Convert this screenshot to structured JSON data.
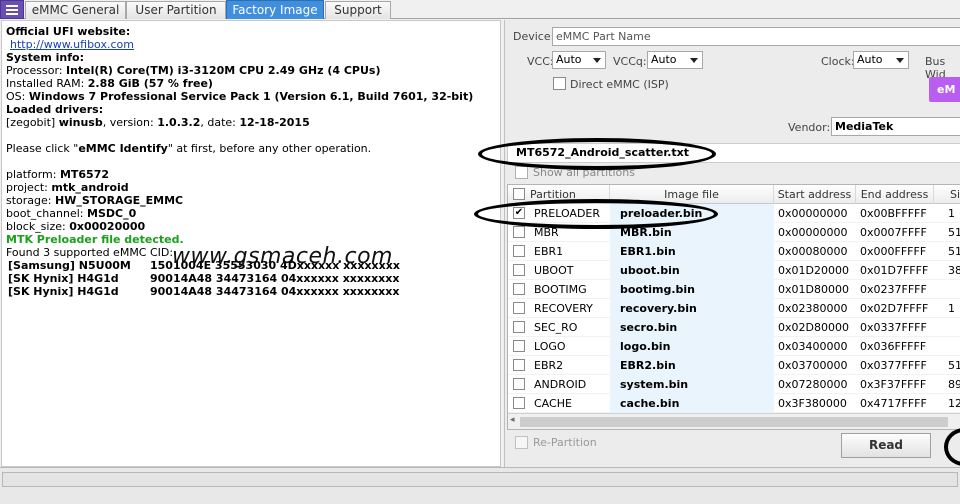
{
  "tabs": [
    {
      "label": "eMMC General"
    },
    {
      "label": "User Partition"
    },
    {
      "label": "Factory Image"
    },
    {
      "label": "Support"
    }
  ],
  "log": {
    "official_site_label": "Official UFI website:",
    "official_site_url": "http://www.ufibox.com",
    "system_info_label": "System info:",
    "processor_label": "Processor: ",
    "processor_value": "Intel(R) Core(TM) i3-3120M CPU 2.49 GHz (4 CPUs)",
    "ram_label": "Installed RAM: ",
    "ram_value": "2.88 GiB (57 % free)",
    "os_label": "OS: ",
    "os_value": "Windows 7 Professional Service Pack 1 (Version 6.1, Build 7601, 32-bit)",
    "drivers_label": "Loaded drivers:",
    "driver_prefix": "[zegobit] ",
    "driver_name": "winusb",
    "driver_version_label": ", version: ",
    "driver_version": "1.0.3.2",
    "driver_date_label": ", date: ",
    "driver_date": "12-18-2015",
    "identify_pre": "Please click \"",
    "identify_bold": "eMMC Identify",
    "identify_post": "\" at first, before any other operation.",
    "platform_label": "platform: ",
    "platform_value": "MT6572",
    "project_label": "project: ",
    "project_value": "mtk_android",
    "storage_label": "storage: ",
    "storage_value": "HW_STORAGE_EMMC",
    "boot_channel_label": "boot_channel: ",
    "boot_channel_value": "MSDC_0",
    "block_size_label": "block_size: ",
    "block_size_value": "0x00020000",
    "preloader_detected": "MTK Preloader file detected.",
    "found_cid": "Found 3 supported eMMC CID:",
    "cid_rows": [
      {
        "name": "[Samsung] N5U00M",
        "cid": "1501004E 35553030 4Dxxxxxx xxxxxxxx"
      },
      {
        "name": "[SK Hynix] H4G1d",
        "cid": "90014A48 34473164 04xxxxxx xxxxxxxx"
      },
      {
        "name": "[SK Hynix] H4G1d",
        "cid": "90014A48 34473164 04xxxxxx xxxxxxxx"
      }
    ]
  },
  "watermark": "www.gsmaceh.com",
  "device": {
    "device_label": "Device:",
    "device_placeholder": "eMMC Part Name",
    "vcc_label": "VCC:",
    "vcc_value": "Auto",
    "vccq_label": "VCCq:",
    "vccq_value": "Auto",
    "clock_label": "Clock:",
    "clock_value": "Auto",
    "bus_label": "Bus Wid",
    "direct_emmc_label": "Direct eMMC (ISP)",
    "purple_button_label": "eM",
    "vendor_label": "Vendor:",
    "vendor_value": "MediaTek"
  },
  "scatter_file": "MT6572_Android_scatter.txt",
  "show_all_partitions": "Show all partitions",
  "table": {
    "headers": [
      "Partition",
      "Image file",
      "Start address",
      "End address",
      "Siz"
    ],
    "rows": [
      {
        "checked": true,
        "partition": "PRELOADER",
        "image": "preloader.bin",
        "start": "0x00000000",
        "end": "0x00BFFFFF",
        "size": "1"
      },
      {
        "checked": false,
        "partition": "MBR",
        "image": "MBR.bin",
        "start": "0x00000000",
        "end": "0x0007FFFF",
        "size": "51"
      },
      {
        "checked": false,
        "partition": "EBR1",
        "image": "EBR1.bin",
        "start": "0x00080000",
        "end": "0x000FFFFF",
        "size": "51"
      },
      {
        "checked": false,
        "partition": "UBOOT",
        "image": "uboot.bin",
        "start": "0x01D20000",
        "end": "0x01D7FFFF",
        "size": "38"
      },
      {
        "checked": false,
        "partition": "BOOTIMG",
        "image": "bootimg.bin",
        "start": "0x01D80000",
        "end": "0x0237FFFF",
        "size": ""
      },
      {
        "checked": false,
        "partition": "RECOVERY",
        "image": "recovery.bin",
        "start": "0x02380000",
        "end": "0x02D7FFFF",
        "size": "1"
      },
      {
        "checked": false,
        "partition": "SEC_RO",
        "image": "secro.bin",
        "start": "0x02D80000",
        "end": "0x0337FFFF",
        "size": ""
      },
      {
        "checked": false,
        "partition": "LOGO",
        "image": "logo.bin",
        "start": "0x03400000",
        "end": "0x036FFFFF",
        "size": ""
      },
      {
        "checked": false,
        "partition": "EBR2",
        "image": "EBR2.bin",
        "start": "0x03700000",
        "end": "0x0377FFFF",
        "size": "51"
      },
      {
        "checked": false,
        "partition": "ANDROID",
        "image": "system.bin",
        "start": "0x07280000",
        "end": "0x3F37FFFF",
        "size": "89"
      },
      {
        "checked": false,
        "partition": "CACHE",
        "image": "cache.bin",
        "start": "0x3F380000",
        "end": "0x4717FFFF",
        "size": "12"
      }
    ]
  },
  "re_partition_label": "Re-Partition",
  "read_button_label": "Read",
  "colors": {
    "active_tab": "#3f8fdc",
    "menu_button": "#6a4fb0",
    "purple_button": "#b95ef0",
    "detected_green": "#1aa01a",
    "image_cell_bg": "#e9f4fc"
  }
}
